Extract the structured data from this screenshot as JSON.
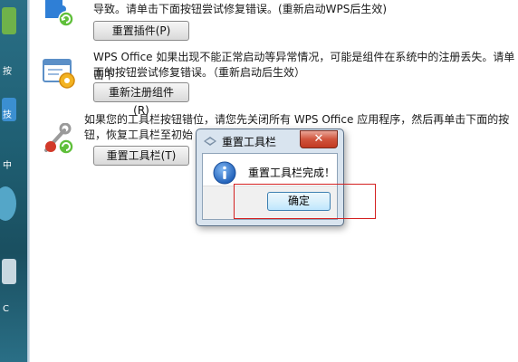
{
  "desktop": {
    "labels": [
      "按",
      "技",
      "中",
      "C"
    ]
  },
  "sections": [
    {
      "icon": "puzzle-refresh-icon",
      "text_lines": [
        "导致。请单击下面按钮尝试修复错误。(重新启动WPS后生效)"
      ],
      "button": "重置插件(P)"
    },
    {
      "icon": "window-gear-icon",
      "text_lines": [
        "WPS Office 如果出现不能正常启动等异常情况，可能是组件在系统中的注册丢失。请单击下",
        "面的按钮尝试修复错误。（重新启动后生效）"
      ],
      "button": "重新注册组件(R)"
    },
    {
      "icon": "wrench-refresh-icon",
      "text_lines": [
        "如果您的工具栏按钮错位，请您先关闭所有 WPS Office 应用程序，然后再单击下面的按",
        "钮，恢复工具栏至初始"
      ],
      "button": "重置工具栏(T)"
    }
  ],
  "dialog": {
    "title": "重置工具栏",
    "close_symbol": "✕",
    "message": "重置工具栏完成！",
    "ok_label": "确定"
  },
  "colors": {
    "highlight": "#d42020",
    "dialog_frame": "#d9e4ef"
  }
}
